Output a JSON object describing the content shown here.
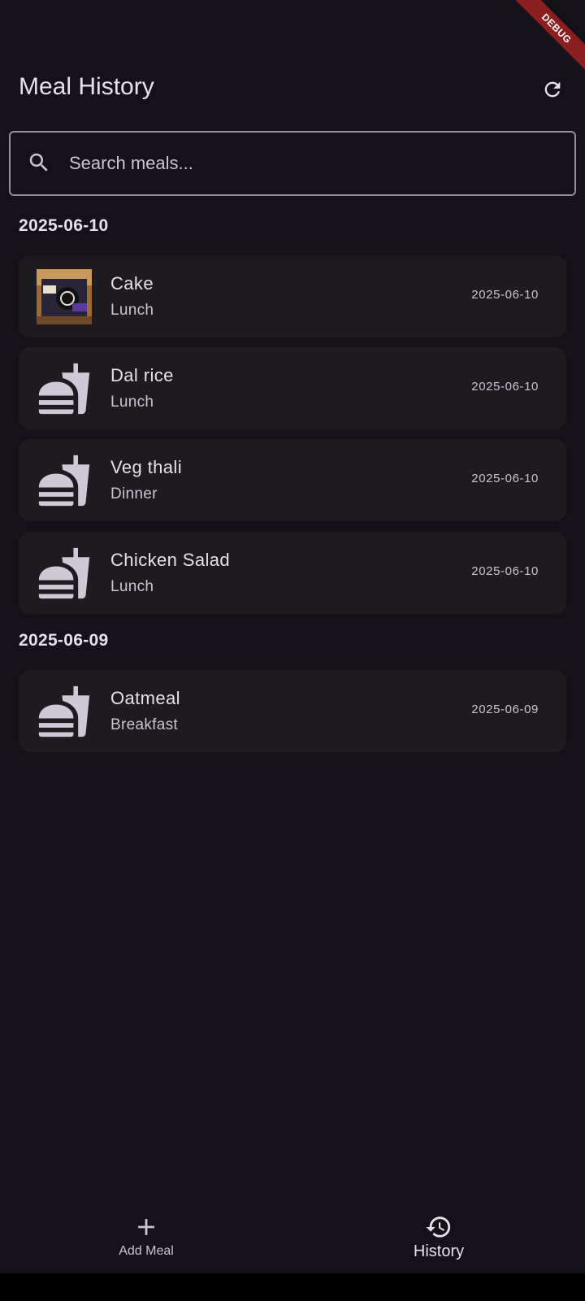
{
  "debug_banner": "DEBUG",
  "header": {
    "title": "Meal History",
    "refresh_icon": "refresh-icon"
  },
  "search": {
    "placeholder": "Search meals...",
    "value": "",
    "icon": "search-icon"
  },
  "sections": [
    {
      "date": "2025-06-10",
      "meals": [
        {
          "name": "Cake",
          "type": "Lunch",
          "date": "2025-06-10",
          "thumbnail": "photo"
        },
        {
          "name": "Dal rice",
          "type": "Lunch",
          "date": "2025-06-10",
          "thumbnail": "fastfood-icon"
        },
        {
          "name": "Veg thali",
          "type": "Dinner",
          "date": "2025-06-10",
          "thumbnail": "fastfood-icon"
        },
        {
          "name": "Chicken Salad",
          "type": "Lunch",
          "date": "2025-06-10",
          "thumbnail": "fastfood-icon"
        }
      ]
    },
    {
      "date": "2025-06-09",
      "meals": [
        {
          "name": "Oatmeal",
          "type": "Breakfast",
          "date": "2025-06-09",
          "thumbnail": "fastfood-icon"
        }
      ]
    }
  ],
  "bottom_nav": {
    "items": [
      {
        "label": "Add Meal",
        "icon": "add-icon",
        "active": false
      },
      {
        "label": "History",
        "icon": "history-icon",
        "active": true
      }
    ]
  },
  "colors": {
    "background": "#141218",
    "card": "#1d1b20",
    "text_primary": "#e6e0e9",
    "text_secondary": "#cac4d0",
    "outline": "#938f99",
    "debug_banner": "#8b1e1e"
  }
}
